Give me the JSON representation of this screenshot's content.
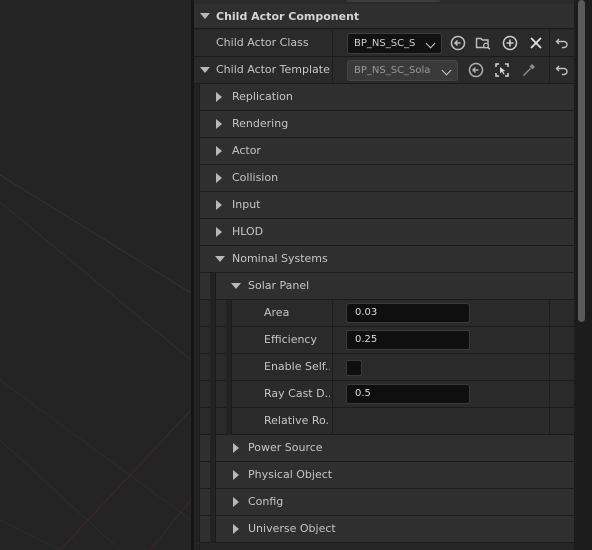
{
  "window": {
    "title": ""
  },
  "details": {
    "section_header": "Child Actor Component",
    "child_actor_class": {
      "label": "Child Actor Class",
      "value": "BP_NS_SC_S"
    },
    "child_actor_template": {
      "label": "Child Actor Template",
      "value": "BP_NS_SC_Sola"
    },
    "categories": [
      {
        "label": "Replication"
      },
      {
        "label": "Rendering"
      },
      {
        "label": "Actor"
      },
      {
        "label": "Collision"
      },
      {
        "label": "Input"
      },
      {
        "label": "HLOD"
      }
    ],
    "nominal_systems": {
      "label": "Nominal Systems"
    },
    "solar_panel": {
      "label": "Solar Panel",
      "properties": [
        {
          "label": "Area",
          "value": "0.03"
        },
        {
          "label": "Efficiency",
          "value": "0.25"
        },
        {
          "label": "Enable Self...",
          "checked": false
        },
        {
          "label": "Ray Cast D...",
          "value": "0.5"
        },
        {
          "label": "Relative Ro..."
        }
      ]
    },
    "sub_categories": [
      {
        "label": "Power Source"
      },
      {
        "label": "Physical Object"
      },
      {
        "label": "Config"
      },
      {
        "label": "Universe Object"
      }
    ]
  },
  "icons": {
    "browse": "arrow-left-circle-icon",
    "find": "folder-search-icon",
    "add": "plus-circle-icon",
    "clear": "close-icon",
    "reset": "reset-arrow-icon",
    "select": "selection-icon",
    "picker": "eyedropper-icon"
  },
  "colors": {
    "panel": "#262626",
    "row": "#2a2a2a",
    "field": "#0f0f0f",
    "text": "#c6c6c6",
    "viewport": "#242424"
  }
}
